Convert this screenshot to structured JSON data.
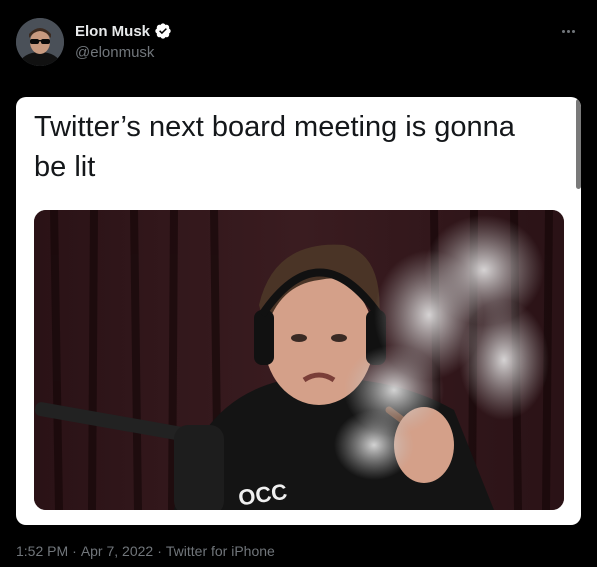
{
  "author": {
    "display_name": "Elon Musk",
    "handle": "@elonmusk",
    "verified": true
  },
  "icons": {
    "verified": "verified-badge-icon",
    "more": "more-options-icon"
  },
  "tweet": {
    "caption": "Twitter’s next board meeting is gonna be lit",
    "image_alt_text": "OCC"
  },
  "meta": {
    "time": "1:52 PM",
    "separator_1": "·",
    "date": "Apr 7, 2022",
    "separator_2": "·",
    "source": "Twitter for iPhone"
  },
  "colors": {
    "background": "#000000",
    "muted": "#71767b",
    "verified": "#ffffff",
    "card": "#ffffff"
  }
}
